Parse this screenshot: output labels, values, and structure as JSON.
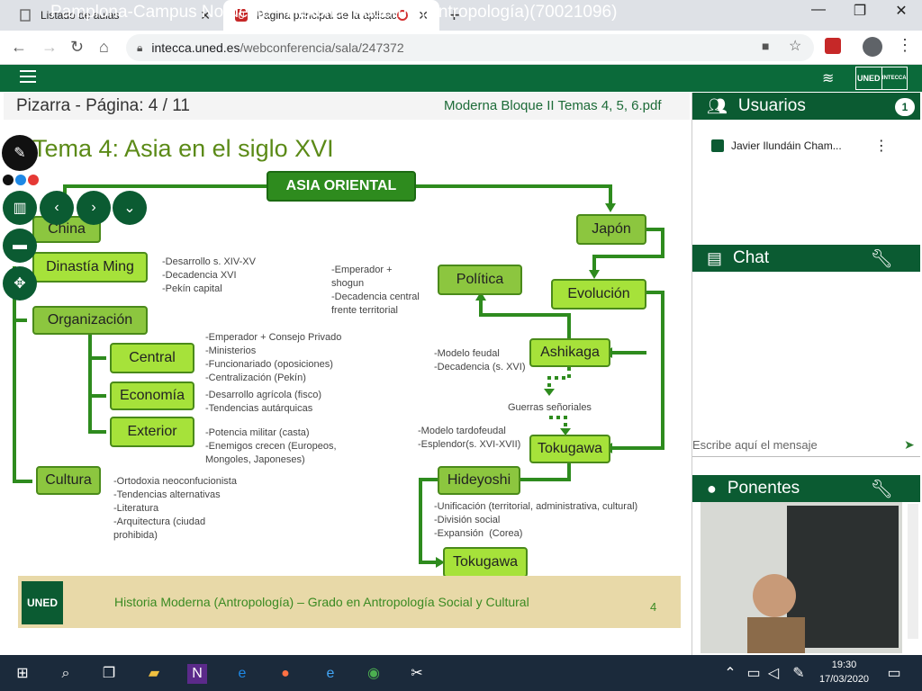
{
  "browser": {
    "tabs": [
      {
        "label": "Listado de aulas"
      },
      {
        "label": "Página principal de la aplicac"
      }
    ],
    "url_host": "intecca.uned.es",
    "url_path": "/webconferencia/sala/247372"
  },
  "app": {
    "title": "Pamplona-Campus Nordeste - Historia Moderna (Antropología)(70021096)",
    "logo_left": "UNED",
    "logo_right": "INTECCA"
  },
  "whiteboard": {
    "title": "Pizarra - Página: 4 / 11",
    "file": "Moderna Bloque II Temas 4, 5, 6.pdf"
  },
  "slide": {
    "title": "Tema 4: Asia en el siglo XVI",
    "boxes": {
      "asia": "ASIA ORIENTAL",
      "china": "China",
      "ming": "Dinastía Ming",
      "organizacion": "Organización",
      "central": "Central",
      "economia": "Economía",
      "exterior": "Exterior",
      "cultura": "Cultura",
      "japon": "Japón",
      "politica": "Política",
      "evolucion": "Evolución",
      "ashikaga": "Ashikaga",
      "tokugawa1": "Tokugawa",
      "hideyoshi": "Hideyoshi",
      "tokugawa2": "Tokugawa"
    },
    "notes": {
      "ming": "-Desarrollo s. XIV-XV\n-Decadencia XVI\n-Pekín capital",
      "central": "-Emperador + Consejo Privado\n-Ministerios\n-Funcionariado (oposiciones)\n-Centralización (Pekín)",
      "economia": "-Desarrollo agrícola (fisco)\n-Tendencias autárquicas",
      "exterior": "-Potencia militar (casta)\n-Enemigos crecen (Europeos,\nMongoles, Japoneses)",
      "cultura": "-Ortodoxia neoconfucionista\n-Tendencias alternativas\n-Literatura\n-Arquitectura (ciudad\nprohibida)",
      "politica": "-Emperador +\nshogun\n-Decadencia central\nfrente territorial",
      "ashikaga": "-Modelo feudal\n-Decadencia (s. XVI)",
      "guerras": "Guerras señoriales",
      "tokugawa": "-Modelo tardofeudal\n-Esplendor(s. XVI-XVII)",
      "hideyoshi": "-Unificación (territorial, administrativa, cultural)\n-División social\n-Expansión  (Corea)"
    },
    "footer_logo": "UNED",
    "footer_text": "Historia Moderna (Antropología) – Grado en Antropología Social y Cultural",
    "footer_page": "4"
  },
  "sidebar": {
    "users_label": "Usuarios",
    "users_count": "1",
    "user_name": "Javier Ilundáin Cham...",
    "chat_label": "Chat",
    "chat_placeholder": "Escribe aquí el mensaje",
    "speakers_label": "Ponentes"
  },
  "taskbar": {
    "time": "19:30",
    "date": "17/03/2020"
  },
  "colors": {
    "brand": "#0b6a3a",
    "box_dark": "#8cc63f",
    "box_light": "#a6e23a"
  }
}
